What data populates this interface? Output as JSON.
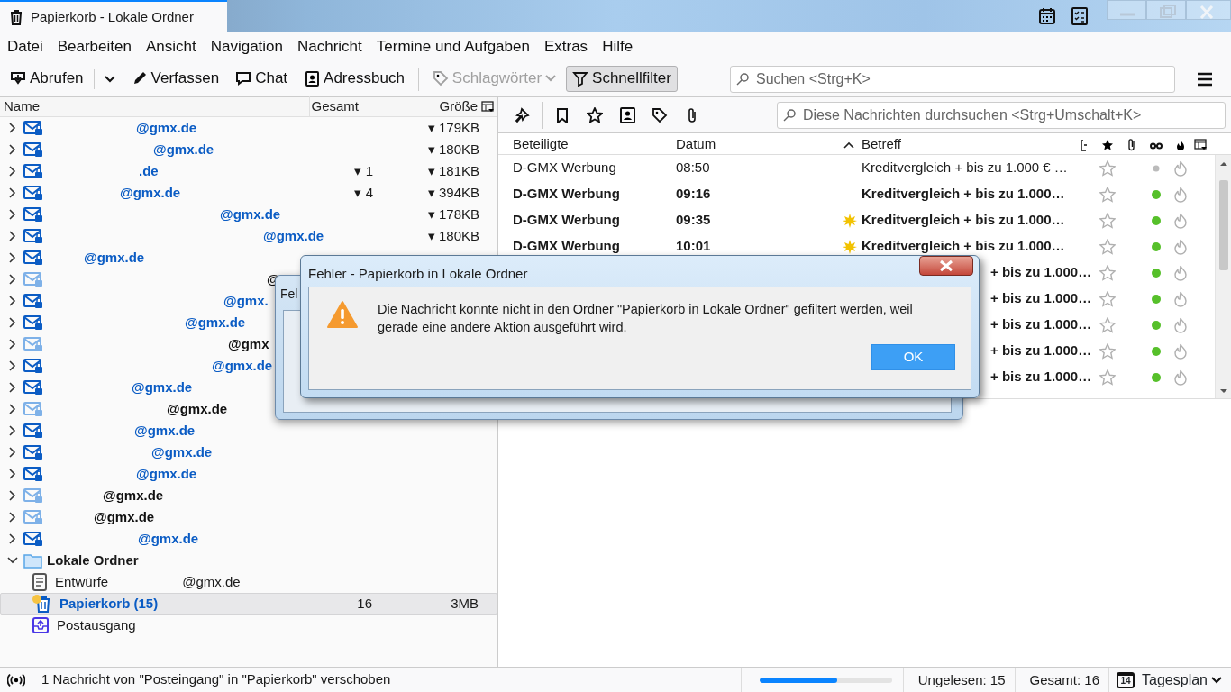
{
  "window": {
    "title": "Papierkorb - Lokale Ordner"
  },
  "menu": [
    {
      "label": "Datei"
    },
    {
      "label": "Bearbeiten"
    },
    {
      "label": "Ansicht"
    },
    {
      "label": "Navigation"
    },
    {
      "label": "Nachricht"
    },
    {
      "label": "Termine und Aufgaben"
    },
    {
      "label": "Extras"
    },
    {
      "label": "Hilfe"
    }
  ],
  "toolbar": [
    {
      "label": "Abrufen",
      "kind": "split",
      "disabled": false,
      "active": false
    },
    {
      "label": "Verfassen",
      "kind": "button",
      "disabled": false,
      "active": false
    },
    {
      "label": "Chat",
      "kind": "button",
      "disabled": false,
      "active": false
    },
    {
      "label": "Adressbuch",
      "kind": "button",
      "disabled": false,
      "active": false
    },
    {
      "label": "Schlagwörter",
      "kind": "menu",
      "disabled": true,
      "active": false
    },
    {
      "label": "Schnellfilter",
      "kind": "button",
      "disabled": false,
      "active": true
    }
  ],
  "search": {
    "placeholder": "Suchen <Strg+K>"
  },
  "folder_pane": {
    "columns": [
      "Name",
      "Gesamt",
      "Größe"
    ],
    "accounts": [
      {
        "name": "@gmx.de",
        "unread": true,
        "expanded": false,
        "size": "▾ 179KB"
      },
      {
        "name": "@gmx.de",
        "unread": true,
        "expanded": false,
        "size": "▾ 180KB"
      },
      {
        "name": ".de",
        "unread": true,
        "expanded": false,
        "total": "▾ 1",
        "size": "▾ 181KB"
      },
      {
        "name": "@gmx.de",
        "unread": true,
        "expanded": false,
        "total": "▾ 4",
        "size": "▾ 394KB"
      },
      {
        "name": "@gmx.de",
        "unread": true,
        "expanded": false,
        "size": "▾ 178KB"
      },
      {
        "name": "@gmx.de",
        "unread": true,
        "expanded": false,
        "size": "▾ 180KB"
      },
      {
        "name": "@gmx.de",
        "unread": true,
        "expanded": false
      },
      {
        "name": "@",
        "unread": false,
        "expanded": false
      },
      {
        "name": "@gmx.",
        "unread": true,
        "expanded": false
      },
      {
        "name": "@gmx.de",
        "unread": true,
        "expanded": false
      },
      {
        "name": "@gmx",
        "unread": false,
        "expanded": false
      },
      {
        "name": "@gmx.de",
        "unread": true,
        "expanded": false
      },
      {
        "name": "@gmx.de",
        "unread": true,
        "expanded": false
      },
      {
        "name": "@gmx.de",
        "unread": false,
        "expanded": false
      },
      {
        "name": "@gmx.de",
        "unread": true,
        "expanded": false
      },
      {
        "name": "@gmx.de",
        "unread": true,
        "expanded": false
      },
      {
        "name": "@gmx.de",
        "unread": true,
        "expanded": false
      },
      {
        "name": "@gmx.de",
        "unread": false,
        "expanded": false
      },
      {
        "name": "@gmx.de",
        "unread": false,
        "expanded": false
      },
      {
        "name": "@gmx.de",
        "unread": true,
        "expanded": false
      }
    ],
    "local": {
      "name": "Lokale Ordner",
      "expanded": true,
      "children": [
        {
          "name": "Entwürfe",
          "extra": "@gmx.de",
          "kind": "drafts",
          "selected": false,
          "unread": false
        },
        {
          "name": "Papierkorb (15)",
          "kind": "trash",
          "selected": true,
          "unread": true,
          "new": true,
          "total": "16",
          "size": "3MB"
        },
        {
          "name": "Postausgang",
          "kind": "outbox",
          "selected": false,
          "unread": false
        }
      ]
    }
  },
  "quick_filter": {
    "placeholder": "Diese Nachrichten durchsuchen <Strg+Umschalt+K>"
  },
  "thread": {
    "columns": [
      {
        "label": "Beteiligte"
      },
      {
        "label": "Datum",
        "sorted": true
      },
      {
        "label": "Betreff"
      }
    ],
    "messages": [
      {
        "from": "D-GMX Werbung",
        "date": "08:50",
        "subject": "Kreditvergleich + bis zu 1.000 € …",
        "unread": false,
        "kind": "full"
      },
      {
        "from": "D-GMX Werbung",
        "date": "09:16",
        "subject": "Kreditvergleich + bis zu 1.000…",
        "unread": true,
        "kind": "full"
      },
      {
        "from": "D-GMX Werbung",
        "date": "09:35",
        "subject": "Kreditvergleich + bis zu 1.000…",
        "unread": true,
        "new": true,
        "kind": "full"
      },
      {
        "from": "D-GMX Werbung",
        "date": "10:01",
        "subject": "Kreditvergleich + bis zu 1.000…",
        "unread": true,
        "new": true,
        "kind": "full"
      },
      {
        "subject": "+ bis zu 1.000…",
        "unread": true,
        "kind": "partial"
      },
      {
        "subject": "+ bis zu 1.000…",
        "unread": true,
        "kind": "partial"
      },
      {
        "subject": "+ bis zu 1.000…",
        "unread": true,
        "kind": "partial"
      },
      {
        "subject": "+ bis zu 1.000…",
        "unread": true,
        "kind": "partial"
      },
      {
        "subject": "+ bis zu 1.000…",
        "unread": true,
        "kind": "partial"
      }
    ]
  },
  "dialogs": [
    {
      "title": "Fel",
      "kind": "back"
    },
    {
      "title": "Fehler - Papierkorb in Lokale Ordner",
      "kind": "alert",
      "message": "Die Nachricht konnte nicht in den Ordner \"Papierkorb in Lokale Ordner\" gefiltert werden, weil gerade eine andere Aktion ausgeführt wird.",
      "button": "OK"
    }
  ],
  "status_bar": {
    "text": "1 Nachricht von \"Posteingang\" in \"Papierkorb\" verschoben",
    "progress": {
      "level": 0.59
    },
    "unread": "Ungelesen: 15",
    "total": "Gesamt: 16",
    "today": {
      "day": "14",
      "label": "Tagesplan"
    }
  }
}
